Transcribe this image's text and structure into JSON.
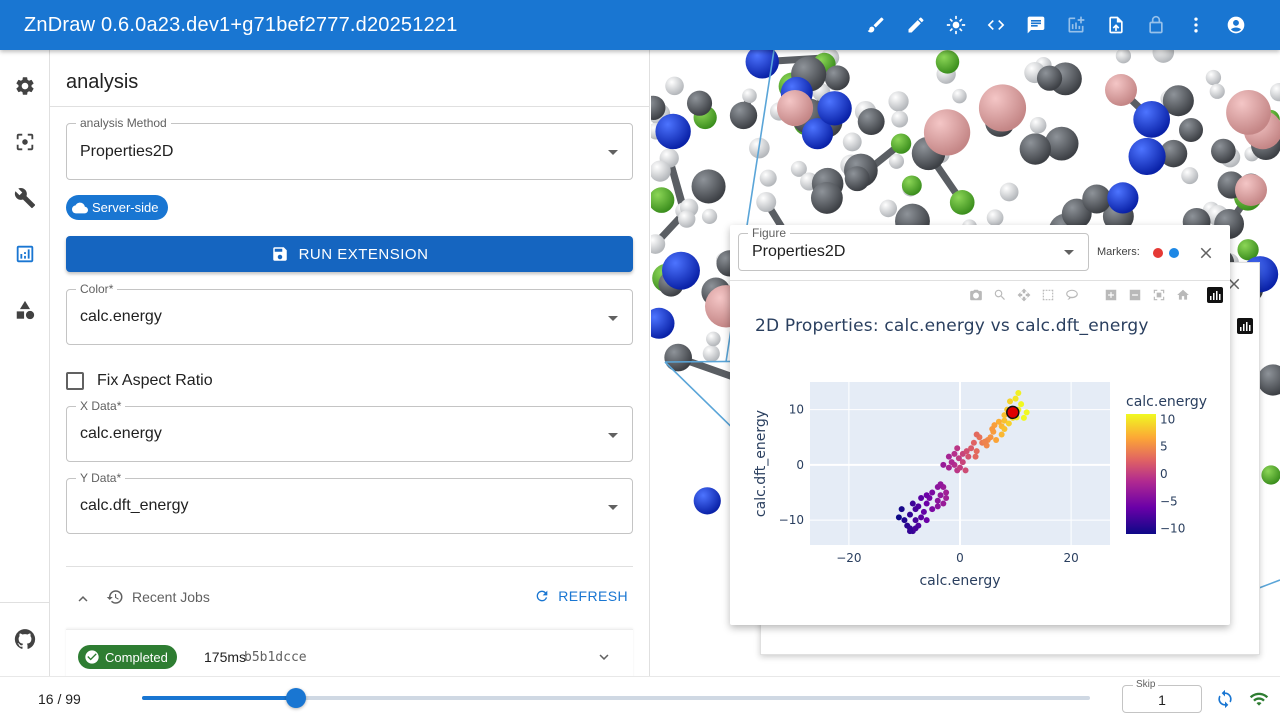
{
  "app": {
    "title": "ZnDraw 0.6.0a23.dev1+g71bef2777.d20251221",
    "toolbar_icons": [
      "brush-icon",
      "pencil-icon",
      "brightness-icon",
      "code-icon",
      "chat-icon",
      "add-chart-icon",
      "upload-file-icon",
      "lock-icon",
      "more-vert-icon",
      "account-icon"
    ]
  },
  "sidebar": {
    "items": [
      {
        "icon": "gear-icon",
        "active": false
      },
      {
        "icon": "center-focus-icon",
        "active": false
      },
      {
        "icon": "wrench-icon",
        "active": false
      },
      {
        "icon": "analytics-icon",
        "active": true
      },
      {
        "icon": "shapes-icon",
        "active": false
      }
    ],
    "footer_icon": "github-icon"
  },
  "panel": {
    "title": "analysis",
    "method": {
      "label": "analysis Method",
      "value": "Properties2D"
    },
    "server_chip": "Server-side",
    "run_button": "RUN EXTENSION",
    "color": {
      "label": "Color",
      "required": "*",
      "value": "calc.energy"
    },
    "fix_aspect": {
      "label": "Fix Aspect Ratio",
      "checked": false
    },
    "x_data": {
      "label": "X Data",
      "required": "*",
      "value": "calc.energy"
    },
    "y_data": {
      "label": "Y Data",
      "required": "*",
      "value": "calc.dft_energy"
    },
    "recent_jobs": {
      "title": "Recent Jobs",
      "refresh": "REFRESH",
      "jobs": [
        {
          "status": "Completed",
          "duration": "175ms",
          "id": "b5b1dcce"
        }
      ]
    }
  },
  "figure_window": {
    "select_label": "Figure",
    "select_value": "Properties2D",
    "markers_label": "Markers:",
    "marker_colors": [
      "#e53935",
      "#1e88e5"
    ],
    "modebar_icons": [
      "camera-icon",
      "zoom-icon",
      "pan-icon",
      "box-select-icon",
      "lasso-icon",
      "zoom-in-icon",
      "zoom-out-icon",
      "autoscale-icon",
      "reset-axes-icon",
      "plotly-logo-icon"
    ]
  },
  "chart_data": {
    "type": "scatter",
    "title": "2D Properties: calc.energy vs calc.dft_energy",
    "xlabel": "calc.energy",
    "ylabel": "calc.dft_energy",
    "xlim": [
      -27,
      27
    ],
    "ylim": [
      -14.5,
      15
    ],
    "xticks": [
      -20,
      0,
      20
    ],
    "yticks": [
      -10,
      0,
      10
    ],
    "colorbar": {
      "title": "calc.energy",
      "range": [
        -11,
        11
      ],
      "ticks": [
        10,
        5,
        0,
        -5,
        -10
      ],
      "colorscale": "plasma"
    },
    "highlight": {
      "x": 9.5,
      "y": 9.5
    },
    "points": [
      [
        10.5,
        13
      ],
      [
        11,
        11
      ],
      [
        12,
        9.5
      ],
      [
        11.5,
        8.5
      ],
      [
        10.5,
        10
      ],
      [
        9.5,
        8.5
      ],
      [
        8.5,
        10
      ],
      [
        8,
        9
      ],
      [
        9,
        11.5
      ],
      [
        10,
        12
      ],
      [
        8,
        8
      ],
      [
        7.5,
        7
      ],
      [
        7,
        7.8
      ],
      [
        8,
        6.5
      ],
      [
        7.5,
        5.5
      ],
      [
        6,
        6
      ],
      [
        5.5,
        5
      ],
      [
        5,
        4.5
      ],
      [
        4.8,
        3.5
      ],
      [
        6.5,
        4.5
      ],
      [
        4,
        4
      ],
      [
        3.5,
        5
      ],
      [
        2.5,
        4
      ],
      [
        2,
        3
      ],
      [
        3,
        2.5
      ],
      [
        1.5,
        1.5
      ],
      [
        0.5,
        2
      ],
      [
        -0.5,
        3
      ],
      [
        -1,
        2
      ],
      [
        0.5,
        0.5
      ],
      [
        -1,
        0
      ],
      [
        -0.5,
        -1
      ],
      [
        1,
        -1
      ],
      [
        0,
        -0.5
      ],
      [
        -2,
        -0.5
      ],
      [
        -3,
        0
      ],
      [
        -2,
        1.5
      ],
      [
        -1.5,
        0.5
      ],
      [
        1.2,
        2.5
      ],
      [
        -2.5,
        -5
      ],
      [
        -3,
        -4
      ],
      [
        -4,
        -4
      ],
      [
        -2.5,
        -6
      ],
      [
        -3.5,
        -5.5
      ],
      [
        -3,
        -7
      ],
      [
        -4,
        -6.5
      ],
      [
        -5,
        -5
      ],
      [
        -5.5,
        -6
      ],
      [
        -6,
        -7
      ],
      [
        -7,
        -6
      ],
      [
        -7.5,
        -7.5
      ],
      [
        -6.5,
        -8.5
      ],
      [
        -8,
        -8
      ],
      [
        -8.5,
        -7
      ],
      [
        -9,
        -9
      ],
      [
        -7,
        -9.5
      ],
      [
        -8,
        -10
      ],
      [
        -9.5,
        -11
      ],
      [
        -8.5,
        -12
      ],
      [
        -9,
        -11.5
      ],
      [
        -10,
        -10
      ],
      [
        -10.5,
        -8
      ],
      [
        -11,
        -9.5
      ],
      [
        -7.5,
        -11
      ],
      [
        -8,
        -11.5
      ],
      [
        -9,
        -12
      ],
      [
        -6,
        -10
      ],
      [
        -5,
        -8
      ],
      [
        -4,
        -7.5
      ],
      [
        -6,
        -5.5
      ],
      [
        3,
        5.5
      ],
      [
        4.5,
        4.2
      ],
      [
        6.2,
        7.2
      ],
      [
        9.2,
        9
      ],
      [
        10.2,
        8.6
      ],
      [
        8.8,
        7.5
      ],
      [
        5.8,
        6.5
      ],
      [
        2.8,
        1.5
      ],
      [
        -0.2,
        1.2
      ],
      [
        -3.5,
        -3.5
      ]
    ]
  }
}
